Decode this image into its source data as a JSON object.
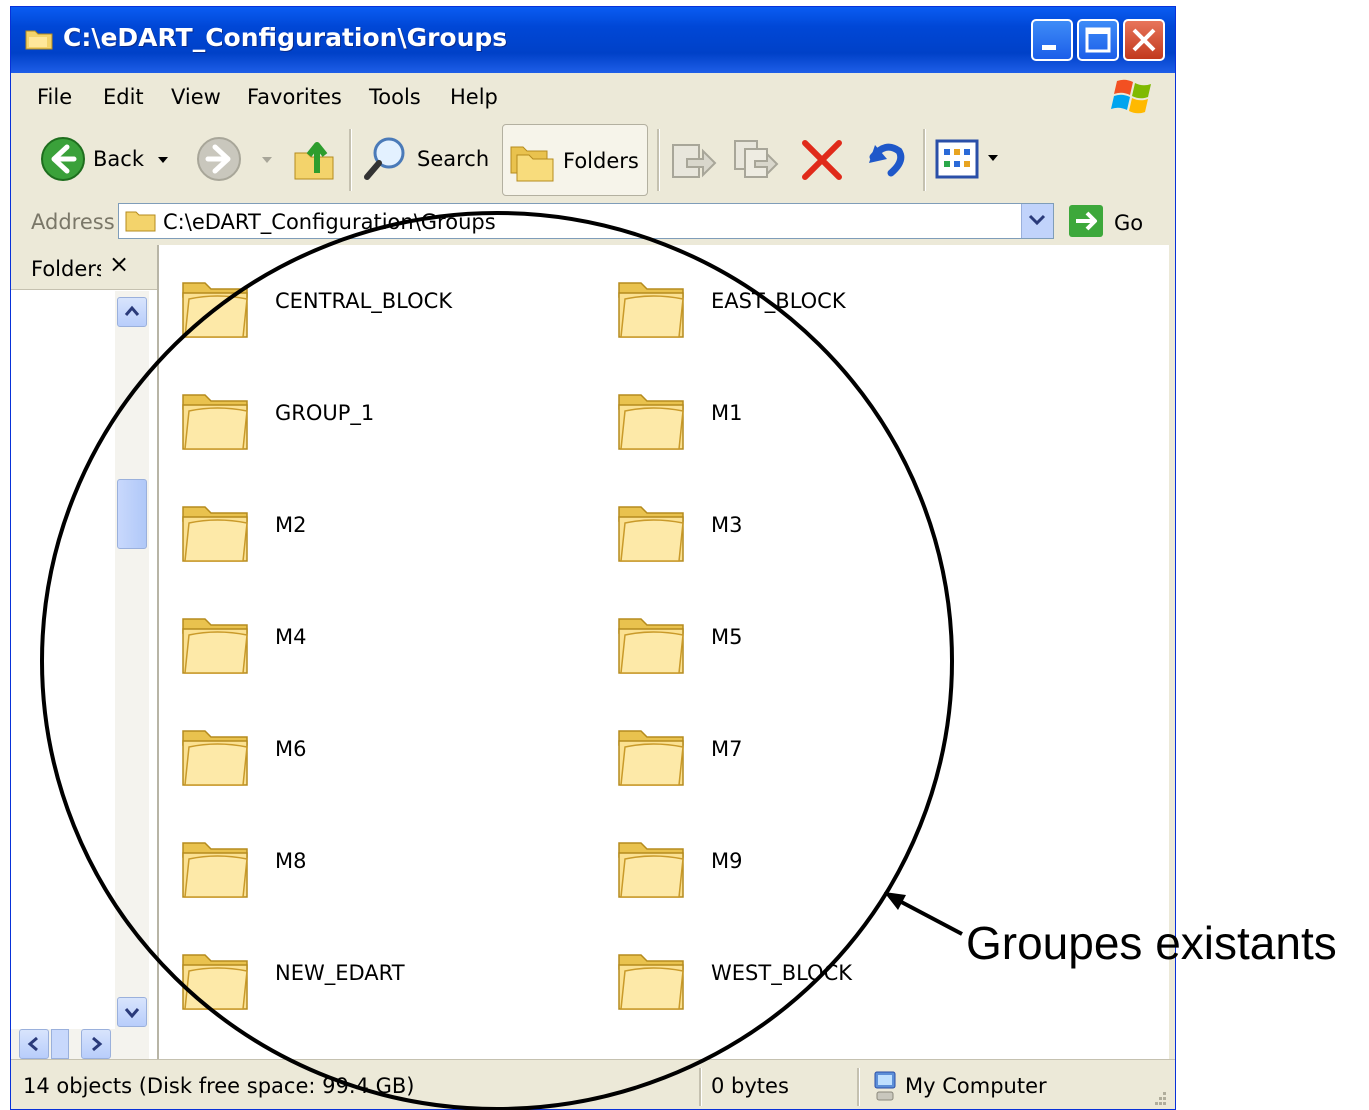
{
  "window": {
    "title": "C:\\eDART_Configuration\\Groups",
    "accent": "#0a5cf2",
    "minimize_icon": "minimize-icon",
    "maximize_icon": "maximize-icon",
    "close_icon": "close-icon"
  },
  "menu": [
    "File",
    "Edit",
    "View",
    "Favorites",
    "Tools",
    "Help"
  ],
  "toolbar": {
    "back_label": "Back",
    "search_label": "Search",
    "folders_label": "Folders"
  },
  "address": {
    "label": "Address",
    "value": "C:\\eDART_Configuration\\Groups",
    "go_label": "Go"
  },
  "folders_pane": {
    "title": "Folders",
    "close_glyph": "×"
  },
  "folders": [
    "CENTRAL_BLOCK",
    "EAST_BLOCK",
    "GROUP_1",
    "M1",
    "M2",
    "M3",
    "M4",
    "M5",
    "M6",
    "M7",
    "M8",
    "M9",
    "NEW_EDART",
    "WEST_BLOCK"
  ],
  "status": {
    "objects": "14 objects (Disk free space: 99.4 GB)",
    "size": "0 bytes",
    "location": "My Computer"
  },
  "annotation": {
    "text": "Groupes existants"
  }
}
